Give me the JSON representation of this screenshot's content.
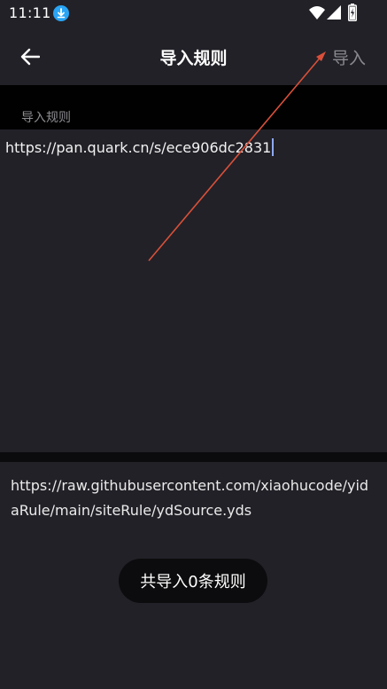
{
  "status_bar": {
    "time": "11:11"
  },
  "app_bar": {
    "title": "导入规则",
    "import_label": "导入"
  },
  "section": {
    "label": "导入规则"
  },
  "input": {
    "value": "https://pan.quark.cn/s/ece906dc2831"
  },
  "source": {
    "url": "https://raw.githubusercontent.com/xiaohucode/yidaRule/main/siteRule/ydSource.yds"
  },
  "toast": {
    "message": "共导入0条规则"
  },
  "colors": {
    "background": "#222127",
    "band": "#010101",
    "caret": "#8fa8ff",
    "annotation": "#d9503a"
  }
}
